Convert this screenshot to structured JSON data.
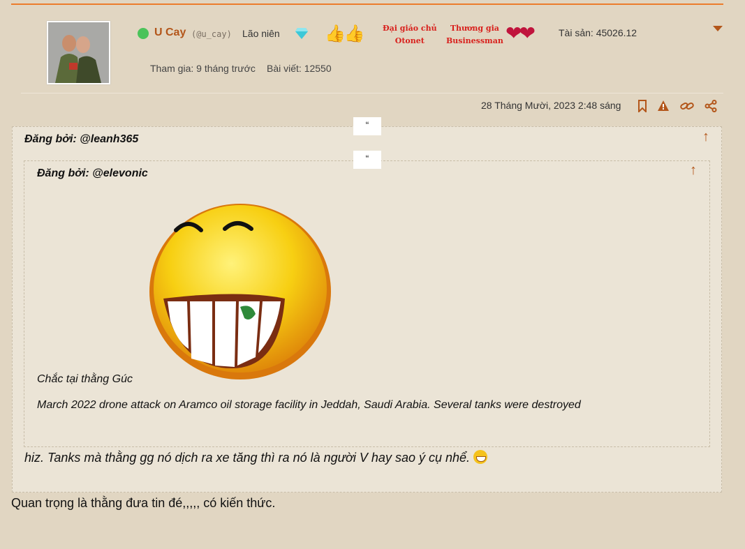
{
  "user": {
    "name": "U Cay",
    "handle": "(@u_cay)",
    "rank": "Lão niên",
    "badges": [
      {
        "line1": "Đại giáo chủ",
        "line2": "Otonet"
      },
      {
        "line1": "Thương gia",
        "line2": "Businessman"
      }
    ],
    "assets": "Tài sản: 45026.12",
    "joined": "Tham gia: 9 tháng trước",
    "posts": "Bài viết: 12550",
    "colors": {
      "accent": "#b3561a",
      "online": "#4bc35a",
      "badge_red": "#d8201c"
    }
  },
  "post": {
    "date": "28 Tháng Mười, 2023 2:48 sáng",
    "icons": [
      "bookmark-icon",
      "warning-icon",
      "link-icon",
      "share-icon"
    ],
    "quote_mark": "“",
    "outer_quote": {
      "posted_by": "Đăng bởi: @leanh365",
      "reply": "hiz. Tanks mà thằng gg nó dịch ra xe tăng thì ra nó là người V hay sao ý cụ nhể."
    },
    "inner_quote": {
      "posted_by": "Đăng bởi: @elevonic",
      "line1": "Chắc tại thằng Gúc",
      "line2": "March 2022 drone attack on Aramco oil storage facility in Jeddah, Saudi Arabia. Several tanks were destroyed"
    },
    "up_arrow": "↑",
    "body": "Quan trọng là thằng đưa tin đé,,,,, có kiến thức."
  }
}
